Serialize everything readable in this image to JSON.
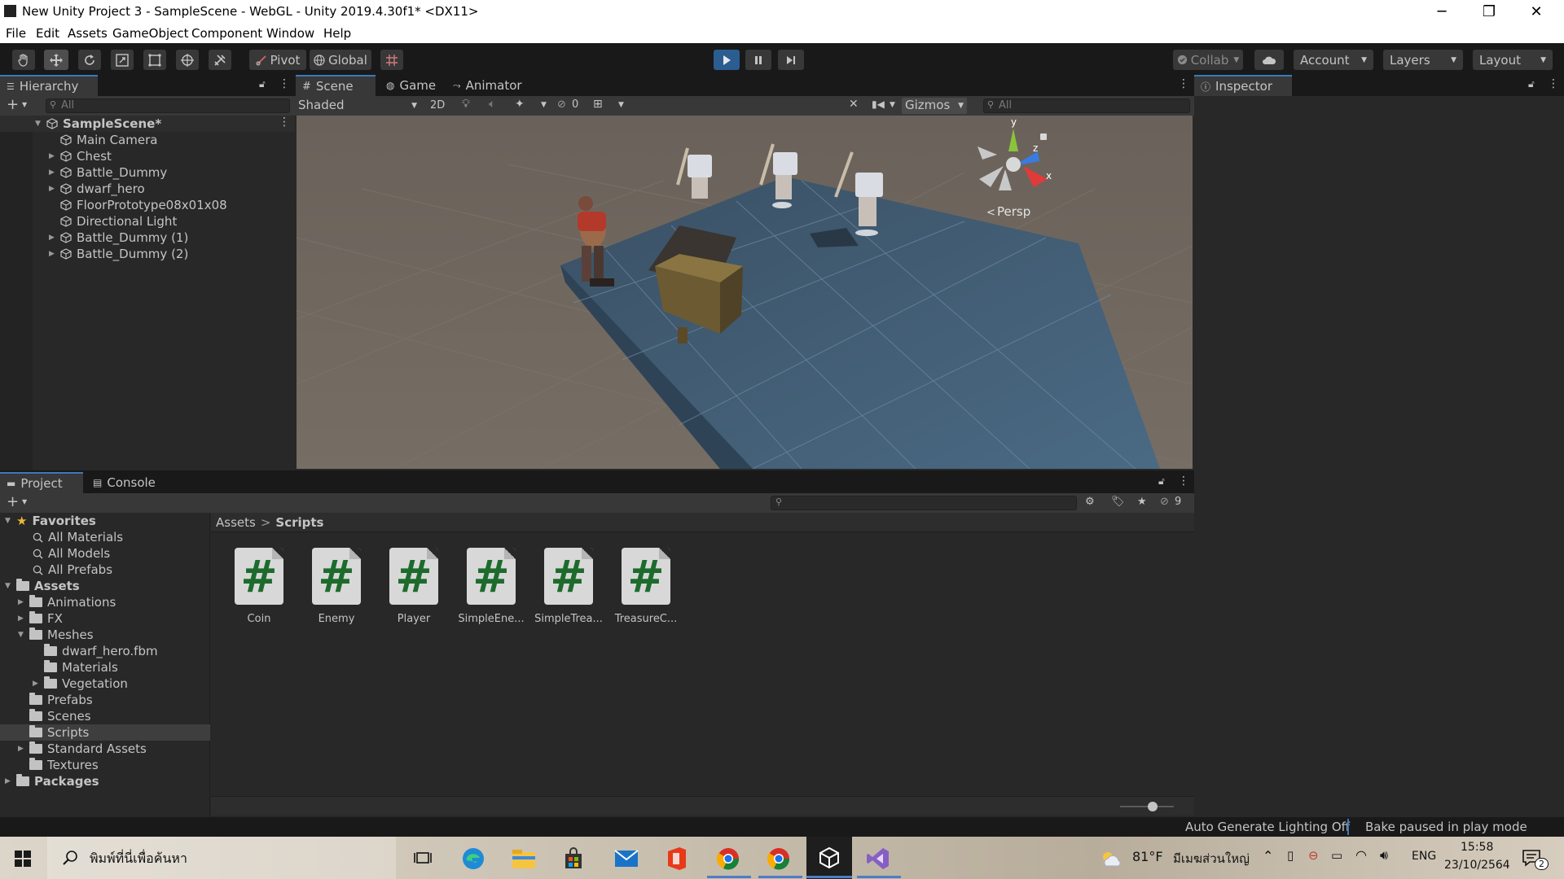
{
  "window": {
    "title": "New Unity Project 3 - SampleScene - WebGL - Unity 2019.4.30f1* <DX11>",
    "controls": {
      "minimize": "─",
      "restore": "❐",
      "close": "✕"
    }
  },
  "menu": [
    "File",
    "Edit",
    "Assets",
    "GameObject",
    "Component",
    "Window",
    "Help"
  ],
  "toolbar": {
    "tools": [
      "hand-tool",
      "move-tool",
      "rotate-tool",
      "scale-tool",
      "rect-tool",
      "transform-tool",
      "custom-tool"
    ],
    "pivot_label": "Pivot",
    "global_label": "Global",
    "collab_label": "Collab",
    "account_label": "Account",
    "layers_label": "Layers",
    "layout_label": "Layout"
  },
  "hierarchy": {
    "tab_label": "Hierarchy",
    "search_placeholder": "All",
    "scene_name": "SampleScene*",
    "items": [
      {
        "label": "Main Camera",
        "expandable": false
      },
      {
        "label": "Chest",
        "expandable": true
      },
      {
        "label": "Battle_Dummy",
        "expandable": true
      },
      {
        "label": "dwarf_hero",
        "expandable": true
      },
      {
        "label": "FloorPrototype08x01x08",
        "expandable": false
      },
      {
        "label": "Directional Light",
        "expandable": false
      },
      {
        "label": "Battle_Dummy (1)",
        "expandable": true
      },
      {
        "label": "Battle_Dummy (2)",
        "expandable": true
      }
    ]
  },
  "scene_view": {
    "tabs": [
      "Scene",
      "Game",
      "Animator"
    ],
    "shading_mode": "Shaded",
    "mode_2d": "2D",
    "hidden_count": "0",
    "gizmos_label": "Gizmos",
    "search_placeholder": "All",
    "persp_label": "Persp",
    "axis_labels": {
      "y": "y",
      "z": "z",
      "x": "x"
    }
  },
  "inspector": {
    "tab_label": "Inspector"
  },
  "project": {
    "tabs": [
      "Project",
      "Console"
    ],
    "hidden_count": "9",
    "favorites_label": "Favorites",
    "favorites": [
      "All Materials",
      "All Models",
      "All Prefabs"
    ],
    "assets_label": "Assets",
    "folders": [
      {
        "label": "Animations",
        "depth": 1,
        "expandable": true,
        "expanded": false,
        "selected": false
      },
      {
        "label": "FX",
        "depth": 1,
        "expandable": true,
        "expanded": false,
        "selected": false
      },
      {
        "label": "Meshes",
        "depth": 1,
        "expandable": true,
        "expanded": true,
        "selected": false
      },
      {
        "label": "dwarf_hero.fbm",
        "depth": 2,
        "expandable": false,
        "expanded": false,
        "selected": false
      },
      {
        "label": "Materials",
        "depth": 2,
        "expandable": false,
        "expanded": false,
        "selected": false
      },
      {
        "label": "Vegetation",
        "depth": 2,
        "expandable": true,
        "expanded": false,
        "selected": false
      },
      {
        "label": "Prefabs",
        "depth": 1,
        "expandable": false,
        "expanded": false,
        "selected": false
      },
      {
        "label": "Scenes",
        "depth": 1,
        "expandable": false,
        "expanded": false,
        "selected": false
      },
      {
        "label": "Scripts",
        "depth": 1,
        "expandable": false,
        "expanded": false,
        "selected": true
      },
      {
        "label": "Standard Assets",
        "depth": 1,
        "expandable": true,
        "expanded": false,
        "selected": false
      },
      {
        "label": "Textures",
        "depth": 1,
        "expandable": false,
        "expanded": false,
        "selected": false
      }
    ],
    "packages_label": "Packages",
    "breadcrumb": [
      "Assets",
      "Scripts"
    ],
    "breadcrumb_sep": ">",
    "scripts": [
      "Coin",
      "Enemy",
      "Player",
      "SimpleEne...",
      "SimpleTrea...",
      "TreasureC..."
    ],
    "script_glyph": "#"
  },
  "status": {
    "lighting": "Auto Generate Lighting Off",
    "bake": "Bake paused in play mode"
  },
  "taskbar": {
    "search_placeholder": "พิมพ์ที่นี่เพื่อค้นหา",
    "weather_temp": "81°F",
    "weather_desc": "มีเมฆส่วนใหญ่",
    "language": "ENG",
    "time": "15:58",
    "date": "23/10/2564",
    "notification_count": "2"
  },
  "colors": {
    "accent_blue": "#3a79bb",
    "play_active": "#2b5d91",
    "panel_bg": "#282828",
    "toolbar_bg": "#191919",
    "floor_blue": "#3e5a72",
    "sky_brown": "#6f655d"
  }
}
